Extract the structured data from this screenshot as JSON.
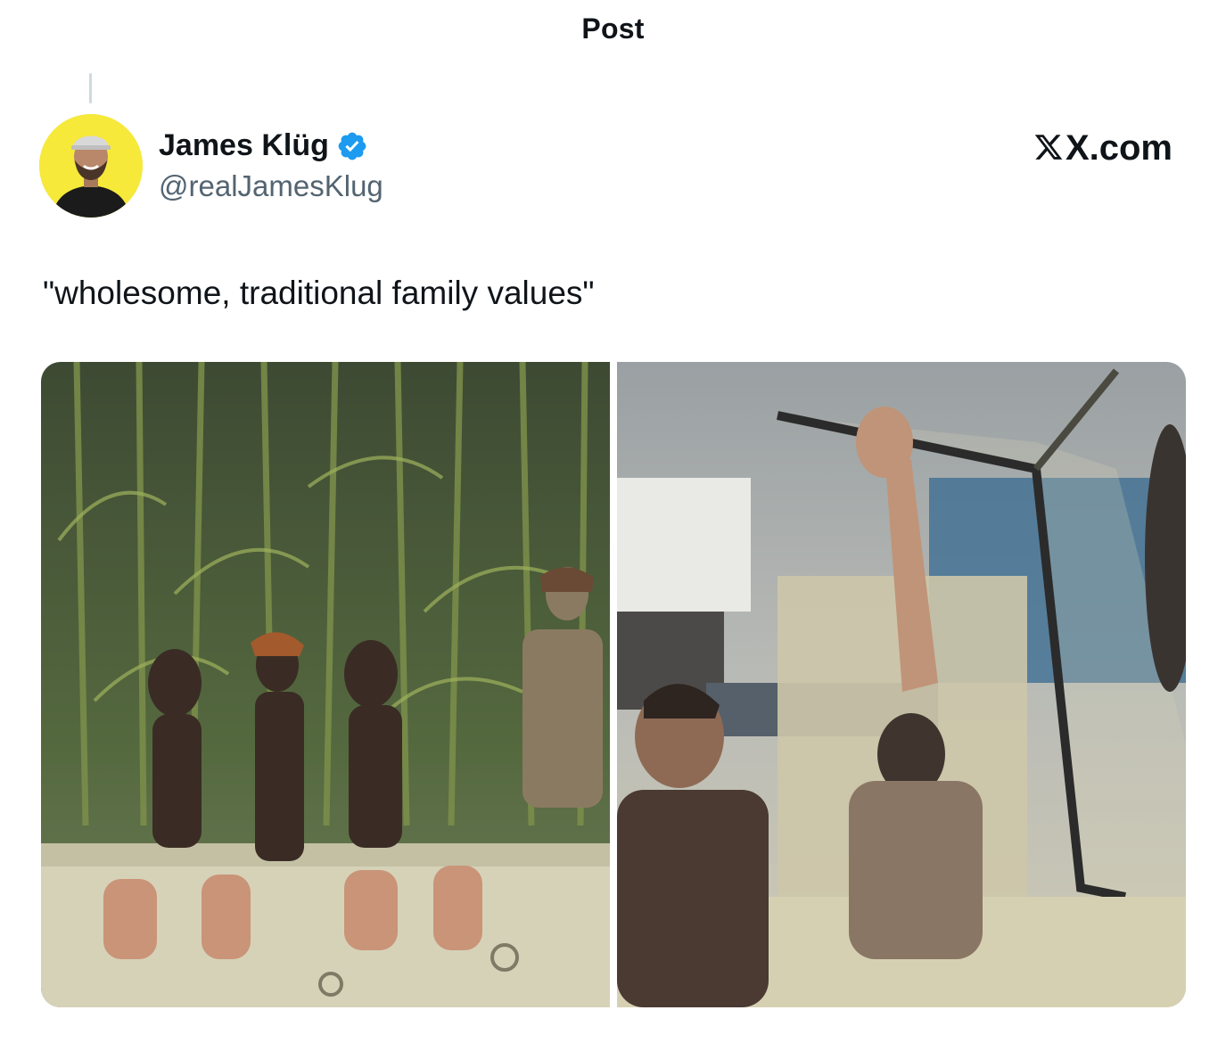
{
  "header": {
    "title": "Post"
  },
  "author": {
    "display_name": "James Klüg",
    "handle": "@realJamesKlug",
    "verified": true,
    "avatar_bg": "#f6e93a"
  },
  "source": {
    "domain": "X.com",
    "icon": "x-logo-icon"
  },
  "post": {
    "text": "\"wholesome, traditional family values\""
  },
  "media": [
    {
      "icon": "photo-cornfield-stage",
      "alt": ""
    },
    {
      "icon": "photo-stadium-truck",
      "alt": ""
    }
  ],
  "colors": {
    "verified": "#1d9bf0",
    "text": "#0f1419",
    "secondary": "#536471"
  }
}
